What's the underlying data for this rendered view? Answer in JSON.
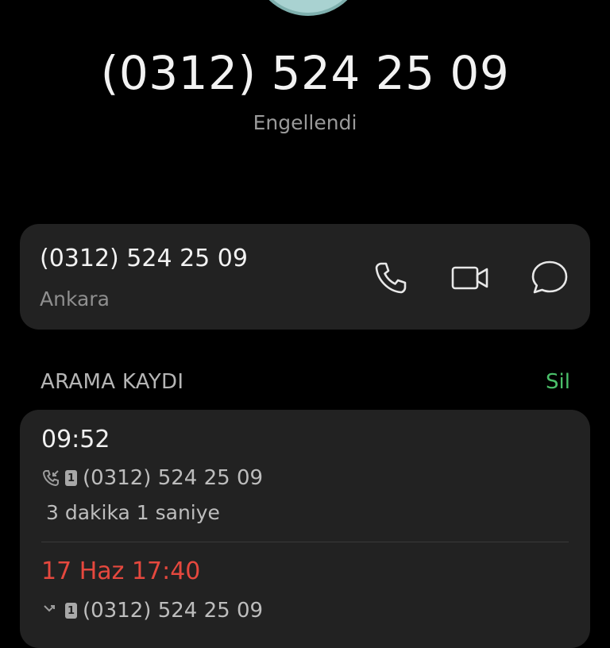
{
  "header": {
    "phone_number": "(0312) 524 25 09",
    "status": "Engellendi"
  },
  "contact": {
    "number": "(0312) 524 25 09",
    "location": "Ankara",
    "actions": [
      {
        "name": "call",
        "icon": "phone-icon"
      },
      {
        "name": "video-call",
        "icon": "video-camera-icon"
      },
      {
        "name": "message",
        "icon": "chat-bubble-icon"
      }
    ]
  },
  "call_log": {
    "title": "ARAMA KAYDI",
    "delete_label": "Sil",
    "entries": [
      {
        "time": "09:52",
        "number": "(0312) 524 25 09",
        "sim": "1",
        "duration": "3 dakika 1 saniye",
        "missed": false
      },
      {
        "time": "17 Haz 17:40",
        "number": "(0312) 524 25 09",
        "sim": "1",
        "missed": true
      }
    ]
  },
  "colors": {
    "background": "#000000",
    "card": "#222222",
    "accent_green": "#4bc06a",
    "missed_red": "#e5483e",
    "avatar": "#a9d2d1"
  }
}
